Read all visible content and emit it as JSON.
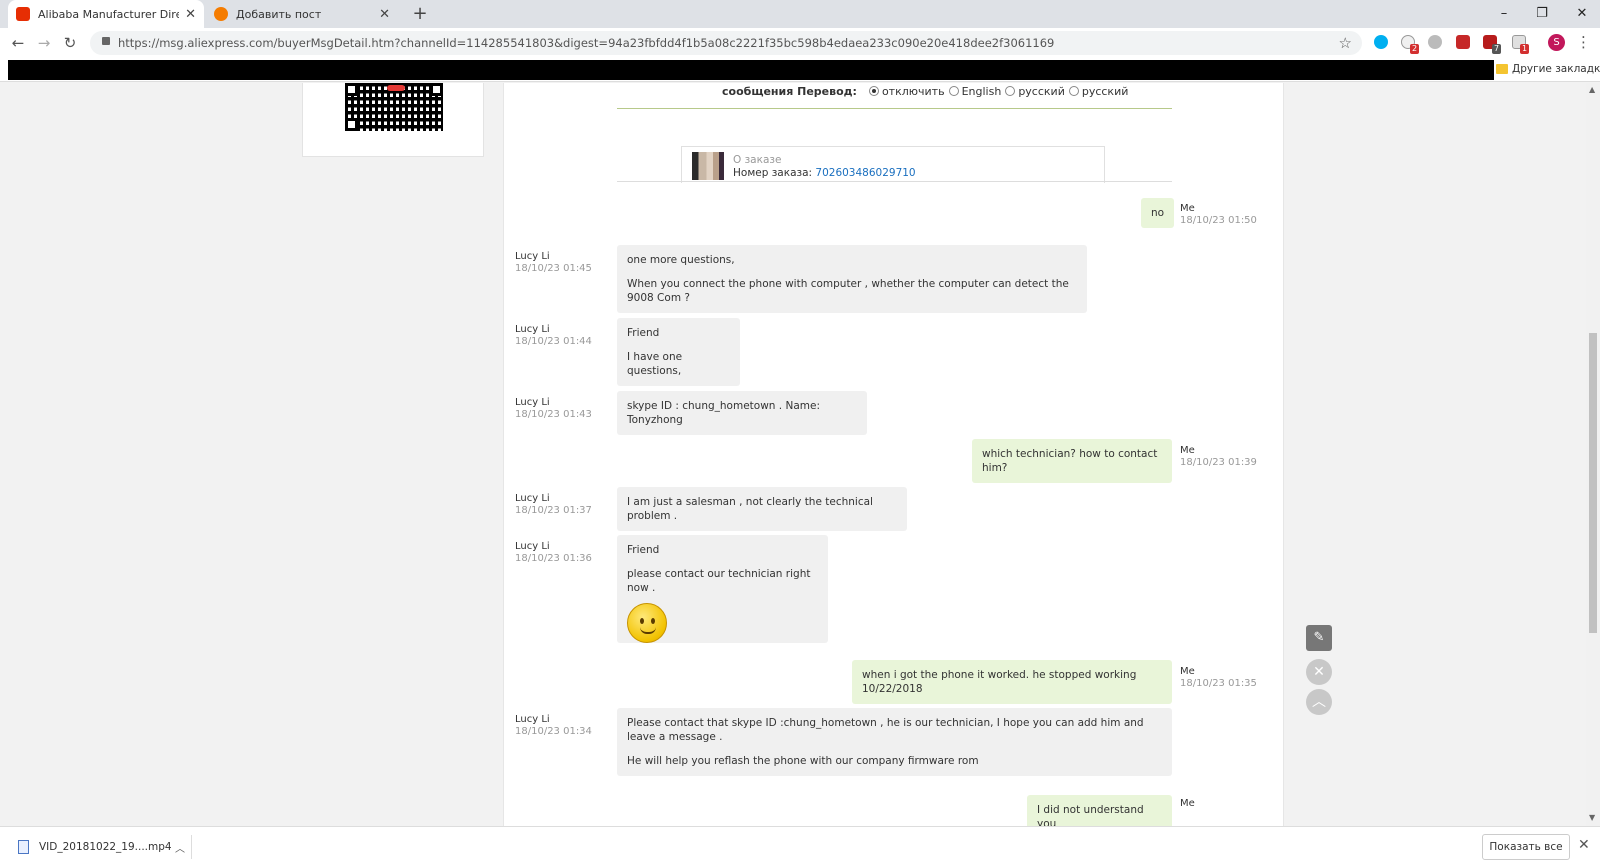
{
  "browser": {
    "tabs": [
      {
        "title": "Alibaba Manufacturer Directory -",
        "favicon_color": "#e62e04"
      },
      {
        "title": "Добавить пост",
        "favicon_color": "#f57c00"
      }
    ],
    "url": "https://msg.aliexpress.com/buyerMsgDetail.htm?channelId=114285541803&digest=94a23fbfdd4f1b5a08c2221f35bc598b4edaea233c090e20e418dee2f3061169",
    "bookmarks_other": "Другие закладки",
    "profile_initial": "S",
    "extension_badges": [
      "2",
      "7",
      "1"
    ]
  },
  "translate": {
    "label": "сообщения Перевод:",
    "options": [
      "отключить",
      "English",
      "русский",
      "русский"
    ]
  },
  "order": {
    "about": "О заказе",
    "number_label": "Номер заказа:",
    "number": "702603486029710"
  },
  "messages": [
    {
      "from": "Me",
      "time": "18/10/23 01:50",
      "side": "me",
      "lines": [
        "no"
      ]
    },
    {
      "from": "Lucy Li",
      "time": "18/10/23 01:45",
      "side": "them",
      "lines": [
        "one more questions,",
        "When you connect the phone with computer ,  whether the computer can detect the 9008 Com ?"
      ]
    },
    {
      "from": "Lucy Li",
      "time": "18/10/23 01:44",
      "side": "them",
      "lines": [
        "Friend",
        "I have one questions,"
      ]
    },
    {
      "from": "Lucy Li",
      "time": "18/10/23 01:43",
      "side": "them",
      "lines": [
        "skype ID : chung_hometown .  Name: Tonyzhong"
      ]
    },
    {
      "from": "Me",
      "time": "18/10/23 01:39",
      "side": "me",
      "lines": [
        "which technician? how to contact him?"
      ]
    },
    {
      "from": "Lucy Li",
      "time": "18/10/23 01:37",
      "side": "them",
      "lines": [
        "I am just a salesman ,  not clearly the technical problem  ."
      ]
    },
    {
      "from": "Lucy Li",
      "time": "18/10/23 01:36",
      "side": "them",
      "lines": [
        "Friend",
        "please contact our technician right now ."
      ]
    },
    {
      "from": "Me",
      "time": "18/10/23 01:35",
      "side": "me",
      "lines": [
        "when i got the phone it worked. he stopped working 10/22/2018"
      ]
    },
    {
      "from": "Lucy Li",
      "time": "18/10/23 01:34",
      "side": "them",
      "lines": [
        "Please contact that skype ID :chung_hometown ,    he is our technician,   I hope you can add him and leave a message  .",
        "He will help you reflash the phone with our company firmware rom"
      ]
    },
    {
      "from": "Me",
      "time": "",
      "side": "me",
      "lines": [
        "I did not understand you"
      ]
    }
  ],
  "download": {
    "filename": "VID_20181022_19....mp4",
    "show_all": "Показать все"
  }
}
